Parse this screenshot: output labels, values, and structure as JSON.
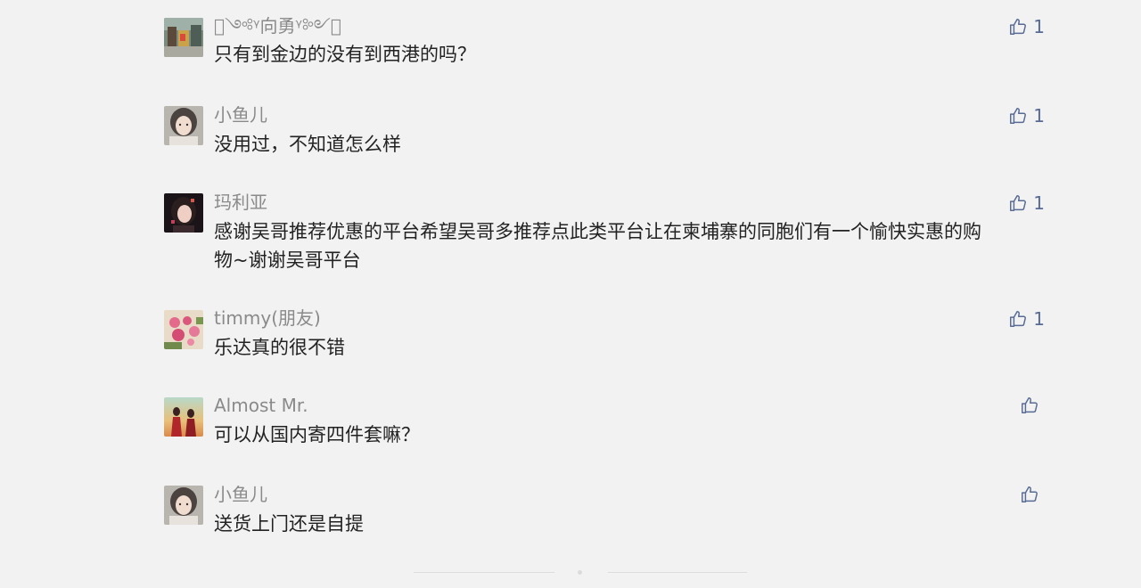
{
  "comments": [
    {
      "name": "􀀀༺ᵞ向勇ᵞ༻􀀀",
      "text": "只有到金边的没有到西港的吗？",
      "likes": "1",
      "avatar": "street-photo-avatar",
      "likeIcon": "thumbs-up-icon"
    },
    {
      "name": "小鱼儿",
      "text": "没用过，不知道怎么样",
      "likes": "1",
      "avatar": "girl-portrait-avatar",
      "likeIcon": "thumbs-up-icon"
    },
    {
      "name": "玛利亚",
      "text": "感谢吴哥推荐优惠的平台希望吴哥多推荐点此类平台让在柬埔寨的同胞们有一个愉快实惠的购物~谢谢吴哥平台",
      "likes": "1",
      "avatar": "girl-night-avatar",
      "likeIcon": "thumbs-up-icon"
    },
    {
      "name": "timmy(朋友)",
      "text": "乐达真的很不错",
      "likes": "1",
      "avatar": "flowers-avatar",
      "likeIcon": "thumbs-up-icon"
    },
    {
      "name": "Almost Mr.",
      "text": "可以从国内寄四件套嘛？",
      "likes": "",
      "avatar": "couple-sunset-avatar",
      "likeIcon": "thumbs-up-icon"
    },
    {
      "name": "小鱼儿",
      "text": "送货上门还是自提",
      "likes": "",
      "avatar": "girl-portrait-avatar",
      "likeIcon": "thumbs-up-icon"
    }
  ],
  "colors": {
    "background": "#f2f2f2",
    "name": "#8a8a8a",
    "text": "#222222",
    "like": "#576b95",
    "divider": "#dcdcdc"
  }
}
